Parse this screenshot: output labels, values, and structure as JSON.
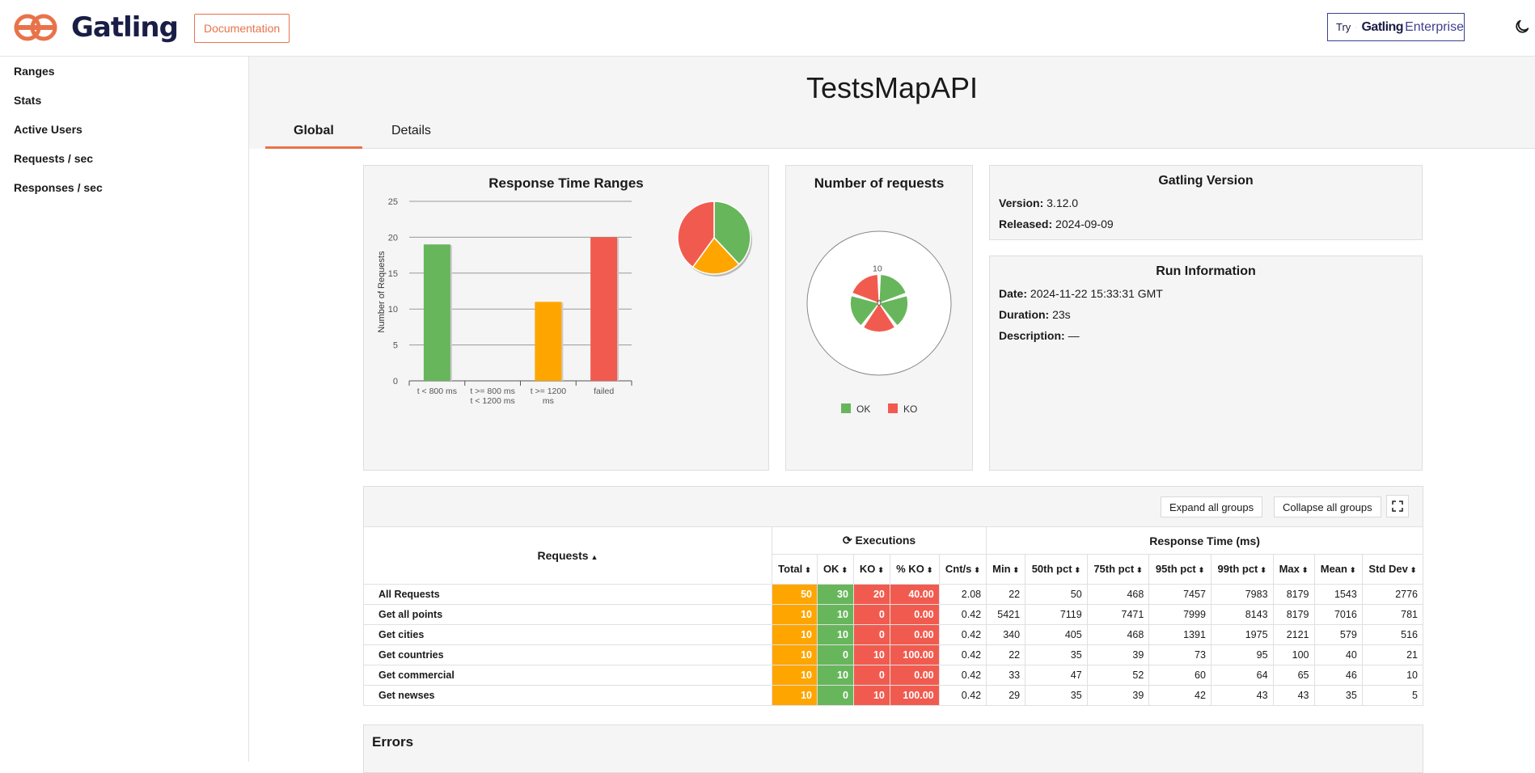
{
  "header": {
    "brand": "Gatling",
    "documentation_label": "Documentation",
    "try_label": "Try",
    "enterprise_brand": "Gatling",
    "enterprise_word": "Enterprise",
    "theme_icon": "moon-icon"
  },
  "sidebar": {
    "items": [
      {
        "label": "Ranges"
      },
      {
        "label": "Stats"
      },
      {
        "label": "Active Users"
      },
      {
        "label": "Requests / sec"
      },
      {
        "label": "Responses / sec"
      }
    ]
  },
  "main": {
    "title": "TestsMapAPI",
    "tabs": [
      {
        "label": "Global"
      },
      {
        "label": "Details"
      }
    ],
    "active_tab": "Global"
  },
  "colors": {
    "ok": "#68b65c",
    "ko": "#f15b4f",
    "warn": "#ffa500",
    "accent": "#e8734a"
  },
  "chart_data": [
    {
      "type": "bar",
      "title": "Response Time Ranges",
      "ylabel": "Number of Requests",
      "categories": [
        "t < 800 ms",
        "t >= 800 ms t < 1200 ms",
        "t >= 1200 ms",
        "failed"
      ],
      "values": [
        19,
        0,
        11,
        20
      ],
      "bar_colors": [
        "#68b65c",
        "#68b65c",
        "#ffa500",
        "#f15b4f"
      ],
      "ylim": [
        0,
        25
      ],
      "yticks": [
        0,
        5,
        10,
        15,
        20,
        25
      ],
      "pie": {
        "values": [
          19,
          11,
          20
        ],
        "colors": [
          "#68b65c",
          "#ffa500",
          "#f15b4f"
        ]
      }
    },
    {
      "type": "pie",
      "title": "Number of requests",
      "axis_label": "10",
      "axis_zero": "0",
      "legend": [
        {
          "name": "OK",
          "color": "#68b65c"
        },
        {
          "name": "KO",
          "color": "#f15b4f"
        }
      ],
      "slices": [
        {
          "name": "Get all points",
          "ok": 10,
          "ko": 0
        },
        {
          "name": "Get cities",
          "ok": 10,
          "ko": 0
        },
        {
          "name": "Get countries",
          "ok": 0,
          "ko": 10
        },
        {
          "name": "Get commercial",
          "ok": 10,
          "ko": 0
        },
        {
          "name": "Get newses",
          "ok": 0,
          "ko": 10
        }
      ]
    }
  ],
  "gatling_version": {
    "title": "Gatling Version",
    "version_label": "Version:",
    "version": "3.12.0",
    "released_label": "Released:",
    "released": "2024-09-09"
  },
  "run_info": {
    "title": "Run Information",
    "date_label": "Date:",
    "date": "2024-11-22 15:33:31 GMT",
    "duration_label": "Duration:",
    "duration": "23s",
    "description_label": "Description:",
    "description": "—"
  },
  "table": {
    "expand_label": "Expand all groups",
    "collapse_label": "Collapse all groups",
    "requests_header": "Requests",
    "executions_header": "Executions",
    "response_time_header": "Response Time (ms)",
    "columns": [
      "Total",
      "OK",
      "KO",
      "% KO",
      "Cnt/s",
      "Min",
      "50th pct",
      "75th pct",
      "95th pct",
      "99th pct",
      "Max",
      "Mean",
      "Std Dev"
    ],
    "rows": [
      {
        "name": "All Requests",
        "values": [
          "50",
          "30",
          "20",
          "40.00",
          "2.08",
          "22",
          "50",
          "468",
          "7457",
          "7983",
          "8179",
          "1543",
          "2776"
        ]
      },
      {
        "name": "Get all points",
        "values": [
          "10",
          "10",
          "0",
          "0.00",
          "0.42",
          "5421",
          "7119",
          "7471",
          "7999",
          "8143",
          "8179",
          "7016",
          "781"
        ]
      },
      {
        "name": "Get cities",
        "values": [
          "10",
          "10",
          "0",
          "0.00",
          "0.42",
          "340",
          "405",
          "468",
          "1391",
          "1975",
          "2121",
          "579",
          "516"
        ]
      },
      {
        "name": "Get countries",
        "values": [
          "10",
          "0",
          "10",
          "100.00",
          "0.42",
          "22",
          "35",
          "39",
          "73",
          "95",
          "100",
          "40",
          "21"
        ]
      },
      {
        "name": "Get commercial",
        "values": [
          "10",
          "10",
          "0",
          "0.00",
          "0.42",
          "33",
          "47",
          "52",
          "60",
          "64",
          "65",
          "46",
          "10"
        ]
      },
      {
        "name": "Get newses",
        "values": [
          "10",
          "0",
          "10",
          "100.00",
          "0.42",
          "29",
          "35",
          "39",
          "42",
          "43",
          "43",
          "35",
          "5"
        ]
      }
    ]
  },
  "errors": {
    "title": "Errors"
  }
}
